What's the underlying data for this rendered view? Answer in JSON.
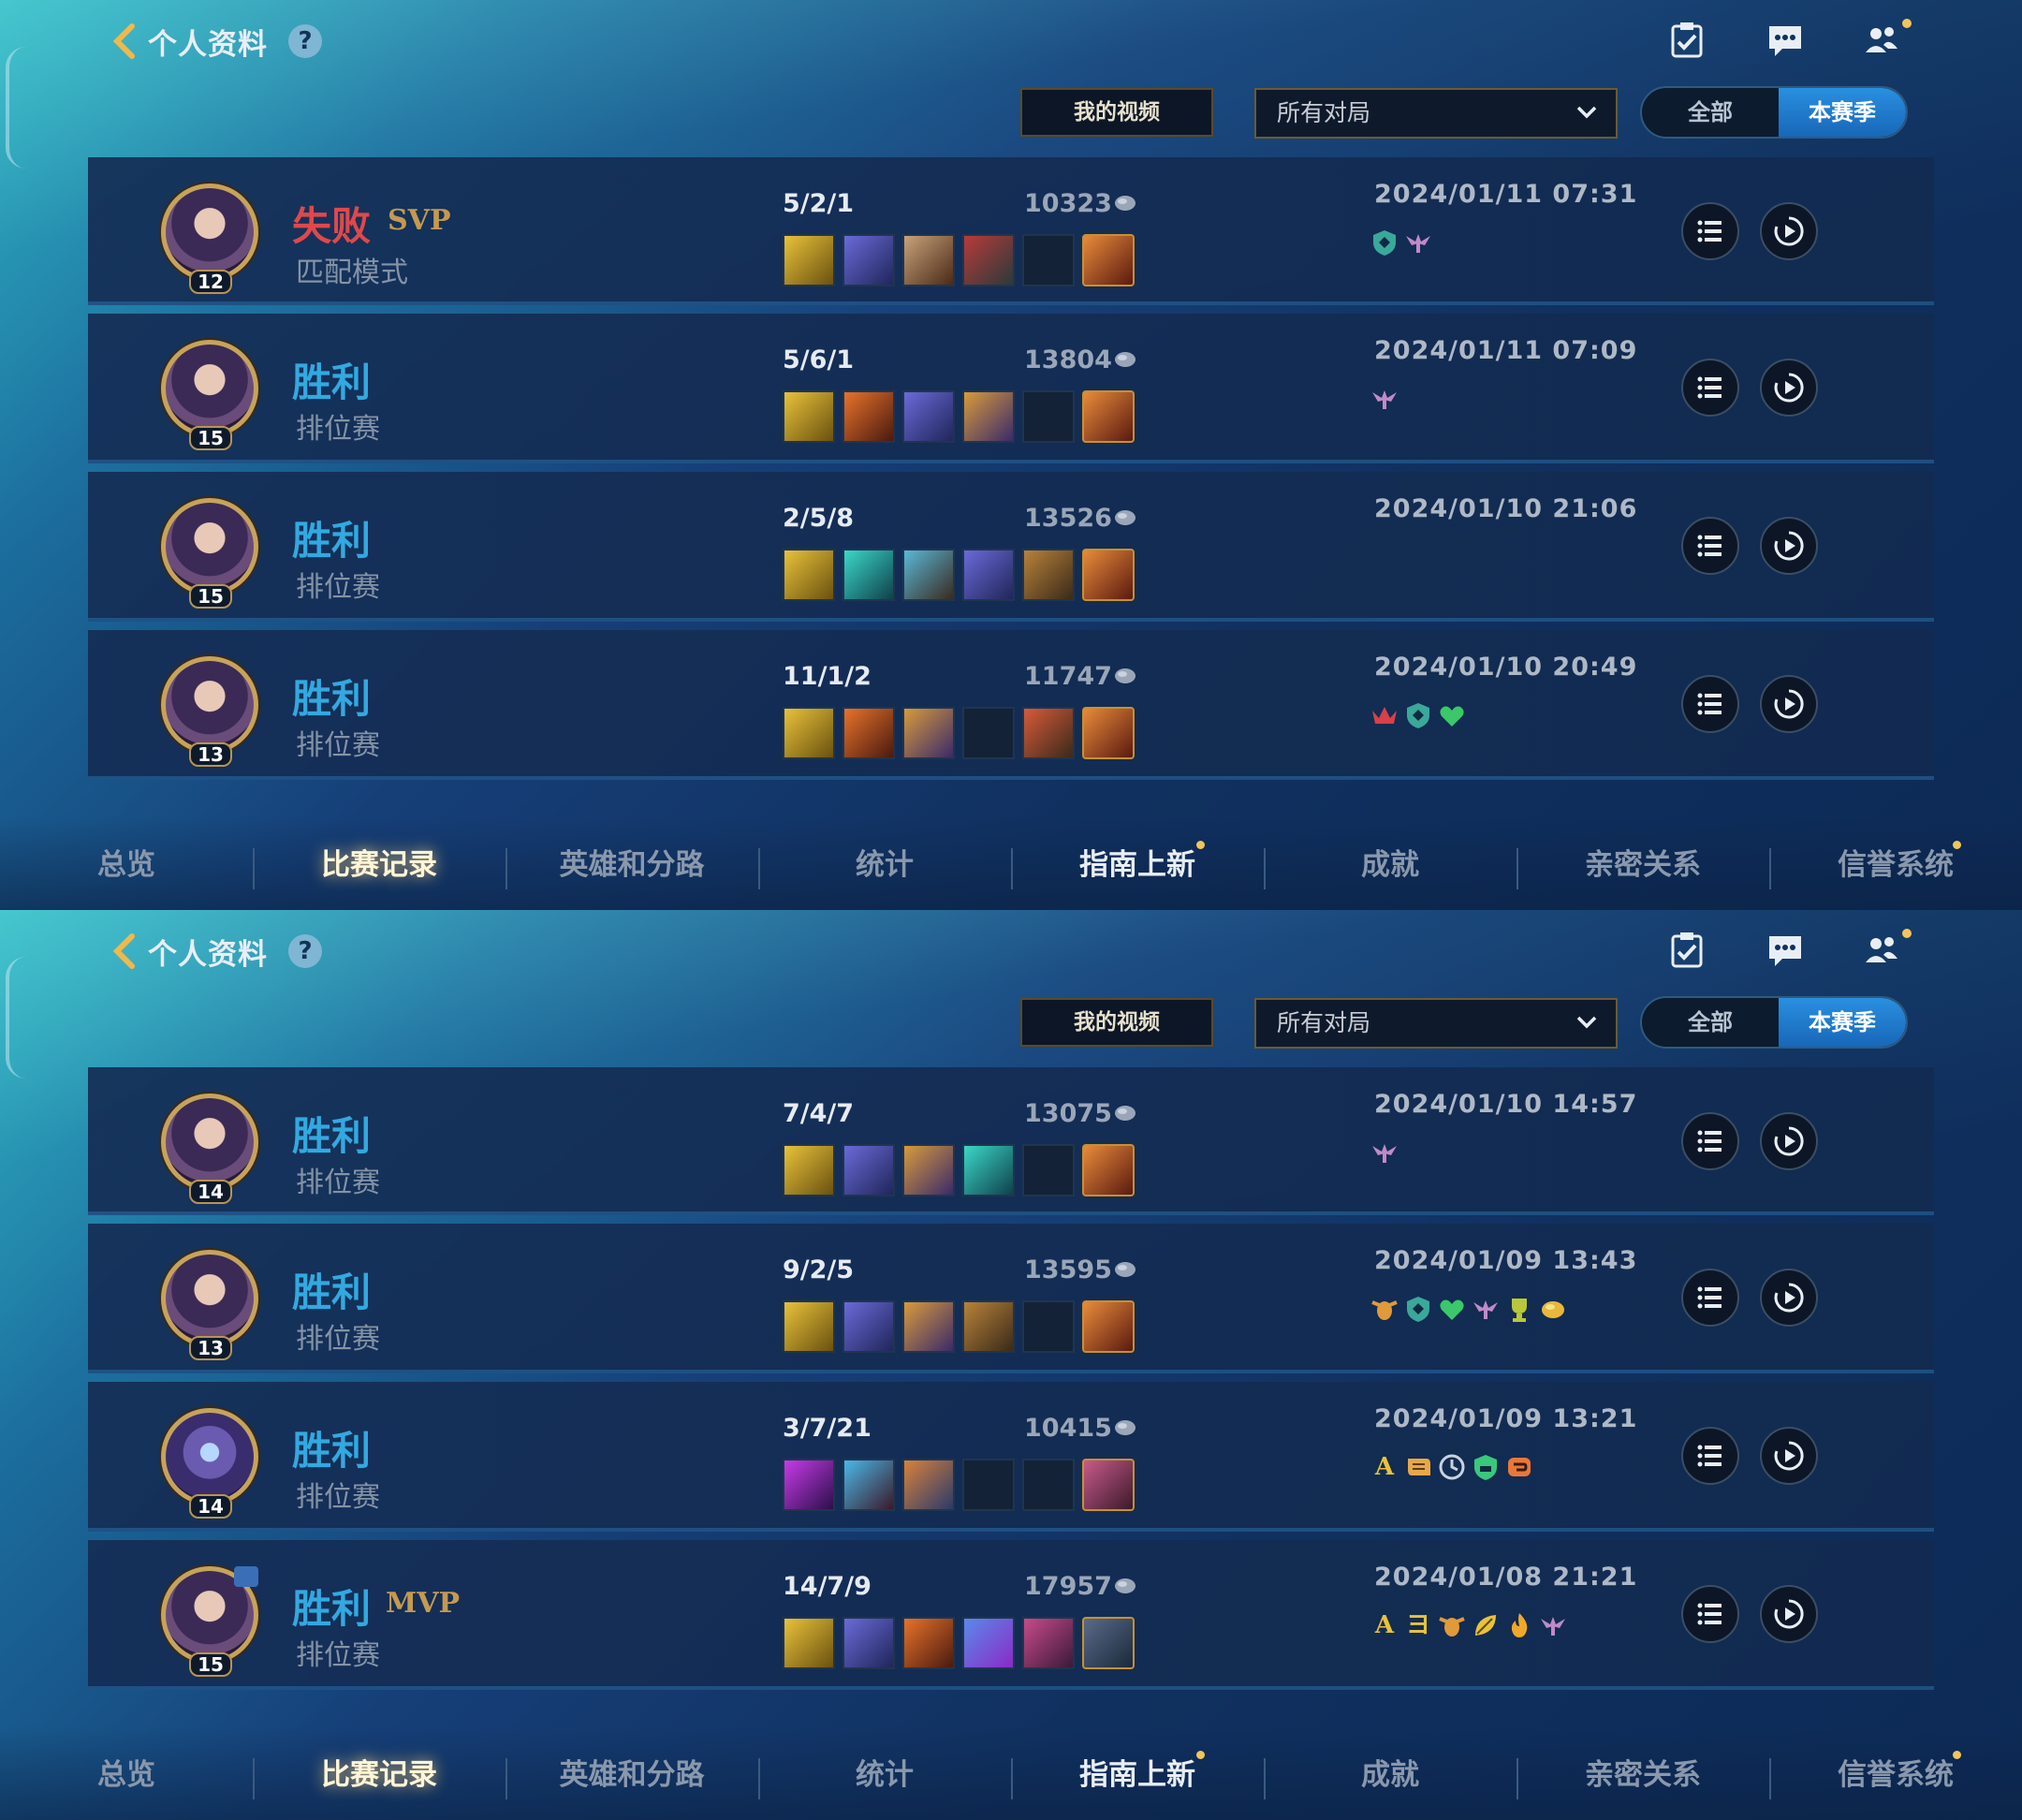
{
  "header": {
    "title": "个人资料",
    "help_label": "?"
  },
  "filters": {
    "my_videos_label": "我的视频",
    "select_value": "所有对局",
    "segment_all": "全部",
    "segment_season": "本赛季"
  },
  "tabs": [
    "总览",
    "比赛记录",
    "英雄和分路",
    "统计",
    "指南上新",
    "成就",
    "亲密关系",
    "信誉系统"
  ],
  "screens": [
    {
      "matches": [
        {
          "result": "失败",
          "badge": "SVP",
          "mode": "匹配模式",
          "level": "12",
          "kda": "5/2/1",
          "gold": "10323",
          "date": "2024/01/11 07:31"
        },
        {
          "result": "胜利",
          "badge": "",
          "mode": "排位赛",
          "level": "15",
          "kda": "5/6/1",
          "gold": "13804",
          "date": "2024/01/11 07:09"
        },
        {
          "result": "胜利",
          "badge": "",
          "mode": "排位赛",
          "level": "15",
          "kda": "2/5/8",
          "gold": "13526",
          "date": "2024/01/10 21:06"
        },
        {
          "result": "胜利",
          "badge": "",
          "mode": "排位赛",
          "level": "13",
          "kda": "11/1/2",
          "gold": "11747",
          "date": "2024/01/10 20:49"
        }
      ]
    },
    {
      "matches": [
        {
          "result": "胜利",
          "badge": "",
          "mode": "排位赛",
          "level": "14",
          "kda": "7/4/7",
          "gold": "13075",
          "date": "2024/01/10 14:57"
        },
        {
          "result": "胜利",
          "badge": "",
          "mode": "排位赛",
          "level": "13",
          "kda": "9/2/5",
          "gold": "13595",
          "date": "2024/01/09 13:43"
        },
        {
          "result": "胜利",
          "badge": "",
          "mode": "排位赛",
          "level": "14",
          "kda": "3/7/21",
          "gold": "10415",
          "date": "2024/01/09 13:21"
        },
        {
          "result": "胜利",
          "badge": "MVP",
          "mode": "排位赛",
          "level": "15",
          "kda": "14/7/9",
          "gold": "17957",
          "date": "2024/01/08 21:21"
        }
      ]
    }
  ],
  "medal_letters": {
    "a": "A",
    "e": "ヨ"
  },
  "colors": {
    "win": "#32a9e0",
    "lose": "#e0484a",
    "gold_badge": "#c59a4f",
    "accent": "#2a8fe0"
  }
}
